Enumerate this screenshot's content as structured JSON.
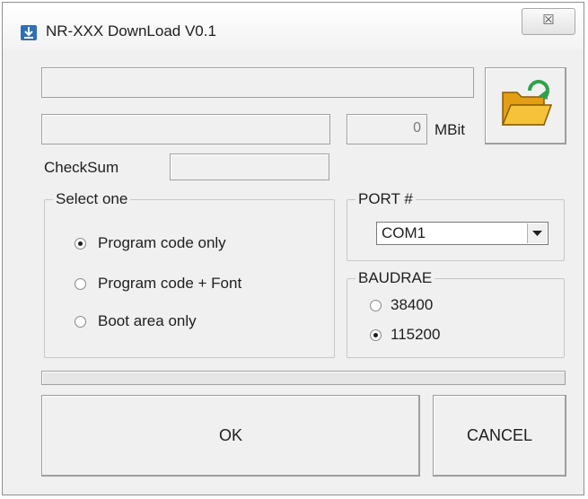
{
  "window": {
    "title": "NR-XXX DownLoad V0.1",
    "close_symbol": "☒"
  },
  "file_path": {
    "value": ""
  },
  "file_info": {
    "value": ""
  },
  "size": {
    "value": "0",
    "unit": "MBit"
  },
  "checksum": {
    "label": "CheckSum",
    "value": ""
  },
  "select_group": {
    "title": "Select one",
    "options": [
      {
        "label": "Program code only",
        "checked": true
      },
      {
        "label": "Program code + Font",
        "checked": false
      },
      {
        "label": "Boot area only",
        "checked": false
      }
    ]
  },
  "port_group": {
    "title": "PORT #",
    "selected": "COM1"
  },
  "baud_group": {
    "title": "BAUDRAE",
    "options": [
      {
        "label": "38400",
        "checked": false
      },
      {
        "label": "115200",
        "checked": true
      }
    ]
  },
  "progress": {
    "value": 0
  },
  "buttons": {
    "ok": "OK",
    "cancel": "CANCEL"
  },
  "icons": {
    "open": "open-folder-icon"
  },
  "colors": {
    "folder": "#f5b520",
    "arrow": "#2fa24a"
  }
}
